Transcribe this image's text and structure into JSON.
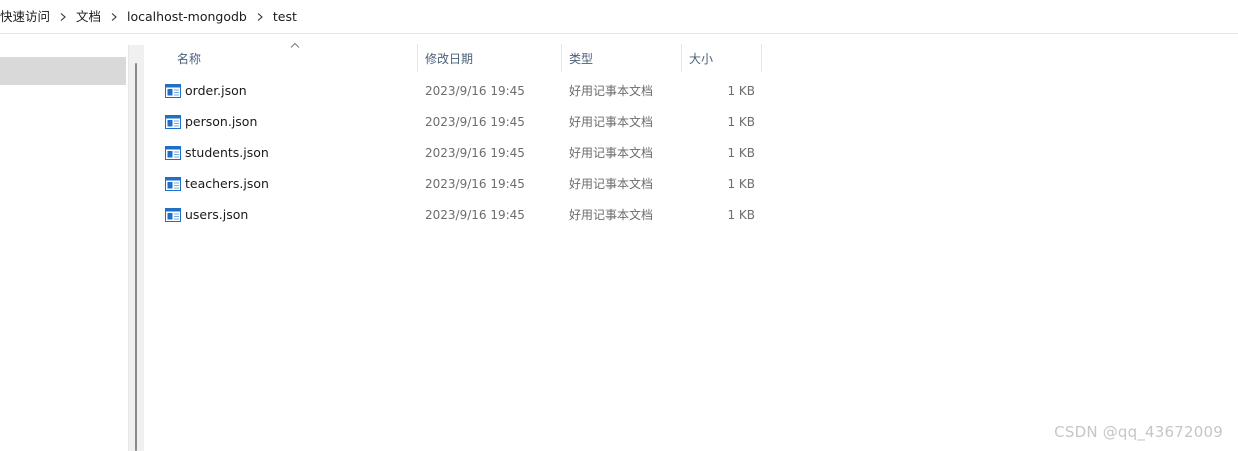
{
  "breadcrumb": {
    "items": [
      "快速访问",
      "文档",
      "localhost-mongodb",
      "test"
    ]
  },
  "columns": {
    "name": "名称",
    "date": "修改日期",
    "type": "类型",
    "size": "大小"
  },
  "files": [
    {
      "name": "order.json",
      "date": "2023/9/16 19:45",
      "type": "好用记事本文档",
      "size": "1 KB"
    },
    {
      "name": "person.json",
      "date": "2023/9/16 19:45",
      "type": "好用记事本文档",
      "size": "1 KB"
    },
    {
      "name": "students.json",
      "date": "2023/9/16 19:45",
      "type": "好用记事本文档",
      "size": "1 KB"
    },
    {
      "name": "teachers.json",
      "date": "2023/9/16 19:45",
      "type": "好用记事本文档",
      "size": "1 KB"
    },
    {
      "name": "users.json",
      "date": "2023/9/16 19:45",
      "type": "好用记事本文档",
      "size": "1 KB"
    }
  ],
  "watermark": "CSDN @qq_43672009",
  "icons": {
    "breadcrumb_separator": "chevron-right-icon",
    "sort": "sort-ascending-icon",
    "file": "notepad-document-icon"
  },
  "colors": {
    "header_text": "#4c607a",
    "nav_selected": "#d9d9d9",
    "icon_blue": "#1e6fc8"
  }
}
